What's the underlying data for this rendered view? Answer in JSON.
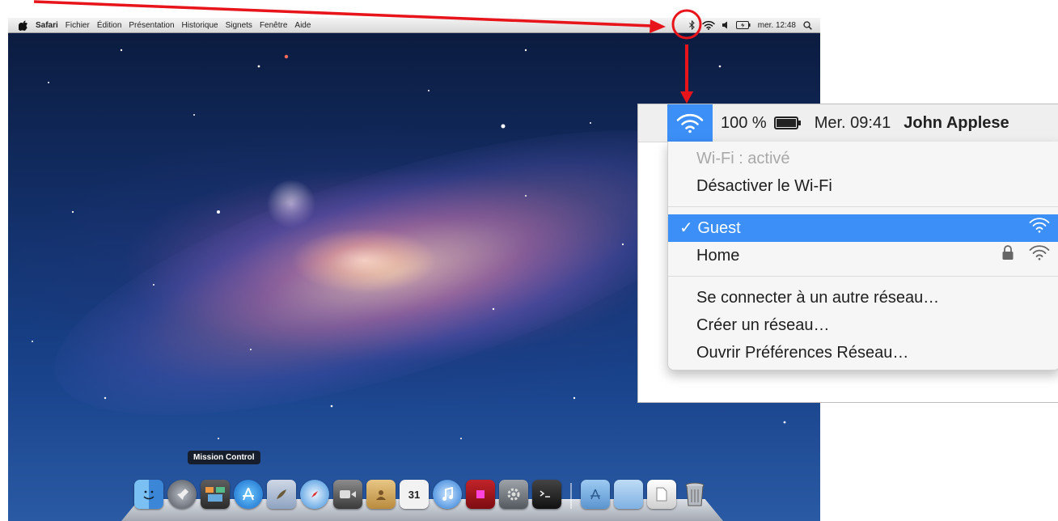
{
  "menubar": {
    "app_name": "Safari",
    "menus": [
      "Fichier",
      "Édition",
      "Présentation",
      "Historique",
      "Signets",
      "Fenêtre",
      "Aide"
    ],
    "clock": "mer. 12:48"
  },
  "dock": {
    "tooltip": "Mission Control",
    "calendar_day": "31"
  },
  "wifi_panel": {
    "battery": "100 %",
    "time": "Mer. 09:41",
    "user": "John Applese",
    "status": "Wi-Fi : activé",
    "toggle": "Désactiver le Wi-Fi",
    "checkmark": "✓",
    "networks": [
      {
        "name": "Guest",
        "locked": false,
        "selected": true
      },
      {
        "name": "Home",
        "locked": true,
        "selected": false
      }
    ],
    "actions": [
      "Se connecter à un autre réseau…",
      "Créer un réseau…",
      "Ouvrir Préférences Réseau…"
    ]
  },
  "colors": {
    "highlight": "#3b8ff7",
    "annotation": "#e8141b"
  }
}
